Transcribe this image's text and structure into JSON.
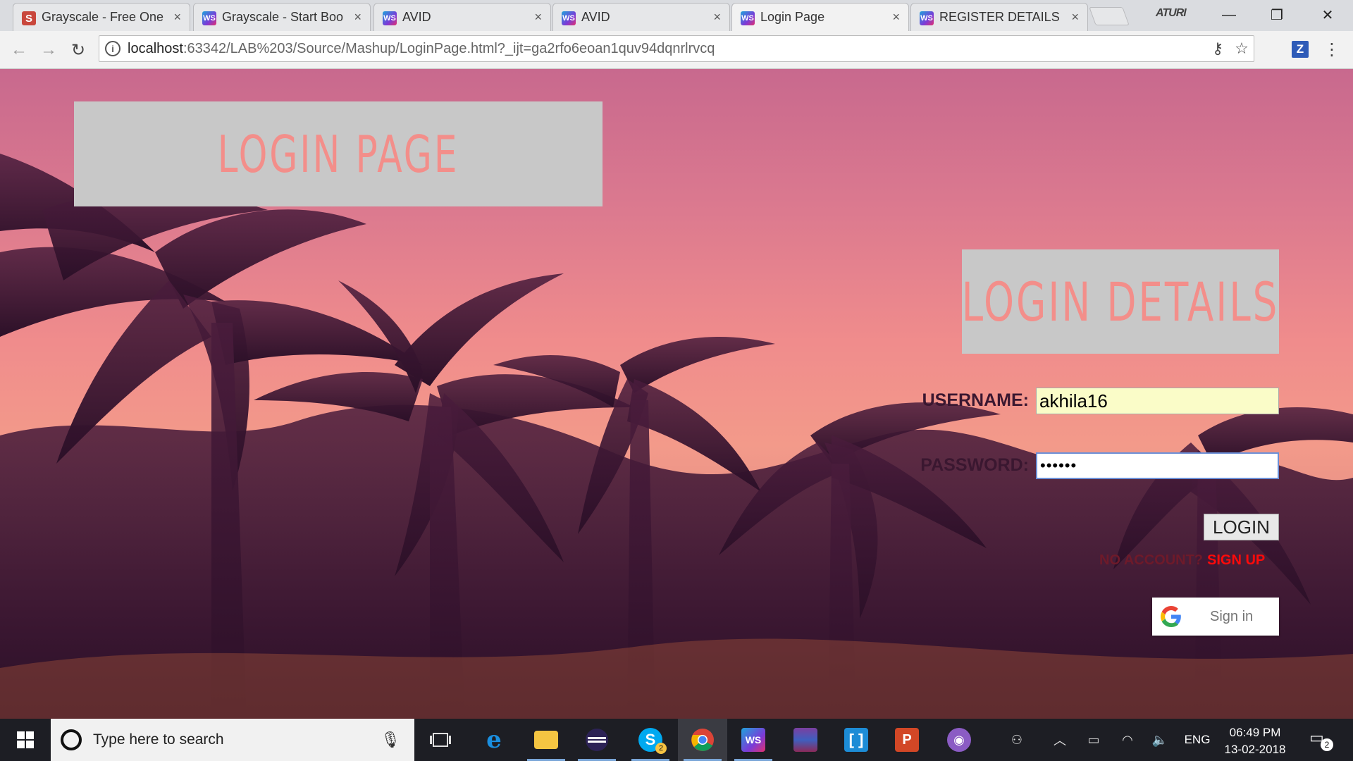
{
  "browser": {
    "tabs": [
      {
        "title": "Grayscale - Free One",
        "favicon": "s-logo-icon"
      },
      {
        "title": "Grayscale - Start Boo",
        "favicon": "webstorm-icon"
      },
      {
        "title": "AVID",
        "favicon": "webstorm-icon"
      },
      {
        "title": "AVID",
        "favicon": "webstorm-icon"
      },
      {
        "title": "Login Page",
        "favicon": "webstorm-icon",
        "active": true
      },
      {
        "title": "REGISTER DETAILS",
        "favicon": "webstorm-icon"
      }
    ],
    "close_glyph": "×",
    "user_name": "ATURI",
    "window_controls": {
      "minimize": "—",
      "restore": "❐",
      "close": "✕"
    },
    "url_host": "localhost",
    "url_rest": ":63342/LAB%203/Source/Mashup/LoginPage.html?_ijt=ga2rfo6eoan1quv94dqnrlrvcq",
    "extension_label": "Z"
  },
  "page": {
    "title": "LOGIN PAGE",
    "details_title": "LOGIN DETAILS",
    "username_label": "USERNAME:",
    "username_value": "akhila16",
    "password_label": "PASSWORD:",
    "password_value": "••••••",
    "login_button": "LOGIN",
    "no_account_text": "NO ACCOUNT?",
    "signup_link": "SIGN UP",
    "google_signin": "Sign in",
    "colors": {
      "heading_text": "#f38e8a",
      "heading_box": "#c8c8c8",
      "signup": "#ff0a0a"
    }
  },
  "taskbar": {
    "search_placeholder": "Type here to search",
    "apps": [
      "task-view-icon",
      "edge-icon",
      "file-explorer-icon",
      "eclipse-icon",
      "skype-icon",
      "chrome-icon",
      "webstorm-icon",
      "winrar-icon",
      "brackets-icon",
      "powerpoint-icon",
      "github-icon"
    ],
    "skype_badge": "2",
    "language": "ENG",
    "time": "06:49 PM",
    "date": "13-02-2018",
    "notification_count": "2"
  }
}
